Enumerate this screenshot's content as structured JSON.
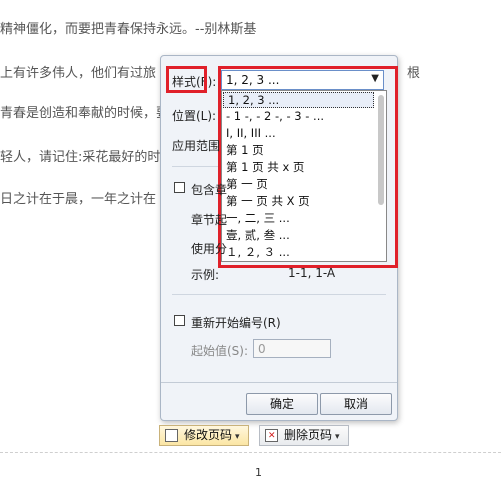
{
  "document": {
    "lines": [
      "精神僵化，而要把青春保持永远。--别林斯基",
      "上有许多伟人，他们有过旅",
      "青春是创造和奉献的时候，要",
      "轻人，请记住:采花最好的时",
      "日之计在于晨，一年之计在"
    ],
    "right_fragment": "根",
    "page_number": "1"
  },
  "dialog": {
    "style_label": "样式(F):",
    "style_value": "1, 2, 3 ...",
    "position_label": "位置(L):",
    "apply_label": "应用范围",
    "include_chapter_label": "包含章",
    "chapter_start_label": "章节起",
    "separator_label": "使用分",
    "example_label": "示例:",
    "example_value": "1-1, 1-A",
    "restart_label": "重新开始编号(R)",
    "start_value_label": "起始值(S):",
    "start_value": "0",
    "ok_label": "确定",
    "cancel_label": "取消",
    "options": [
      "1, 2, 3 ...",
      "- 1 -, - 2 -, - 3 - ...",
      "I, II, III ...",
      "第 1 页",
      "第 1 页 共 x 页",
      "第 一 页",
      "第 一 页 共 X 页",
      "一, 二, 三 ...",
      "壹, 贰, 叁 ...",
      "１, ２, ３ ..."
    ]
  },
  "toolbar": {
    "modify_label": "修改页码",
    "delete_label": "删除页码"
  },
  "colors": {
    "highlight": "#e0202a",
    "dialog_bg": "#f0f3f8"
  }
}
